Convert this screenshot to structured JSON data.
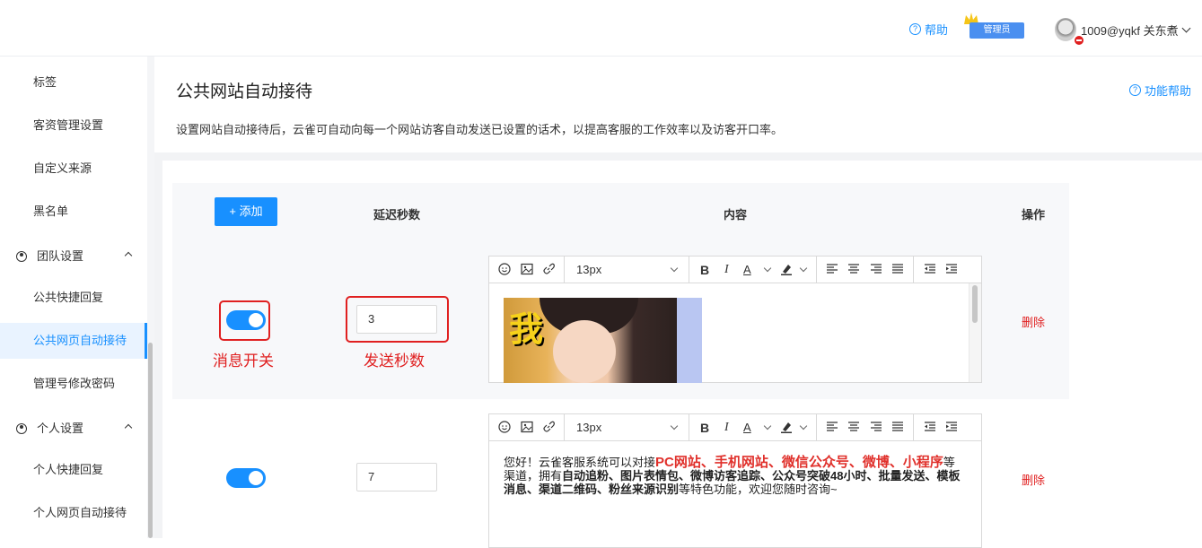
{
  "topbar": {
    "help_label": "帮助",
    "admin_badge": "管理员",
    "user_label": "1009@yqkf 关东煮"
  },
  "sidebar": {
    "items": [
      {
        "label": "标签"
      },
      {
        "label": "客资管理设置"
      },
      {
        "label": "自定义来源"
      },
      {
        "label": "黑名单"
      }
    ],
    "group_team": {
      "label": "团队设置",
      "items": [
        {
          "label": "公共快捷回复"
        },
        {
          "label": "公共网页自动接待"
        },
        {
          "label": "管理号修改密码"
        }
      ]
    },
    "group_personal": {
      "label": "个人设置",
      "items": [
        {
          "label": "个人快捷回复"
        },
        {
          "label": "个人网页自动接待"
        }
      ]
    }
  },
  "page": {
    "title": "公共网站自动接待",
    "func_help": "功能帮助",
    "description": "设置网站自动接待后，云雀可自动向每一个网站访客自动发送已设置的话术，以提高客服的工作效率以及访客开口率。"
  },
  "table": {
    "add_button": "+ 添加",
    "col_delay": "延迟秒数",
    "col_content": "内容",
    "col_action": "操作",
    "rows": [
      {
        "enabled": true,
        "delay": "3",
        "delete_label": "删除",
        "image_char": "我"
      },
      {
        "enabled": true,
        "delay": "7",
        "delete_label": "删除",
        "text_1": "您好！云雀客服系统可以对接",
        "text_red": "PC网站、手机网站、微信公众号、微博、小程序",
        "text_2": "等渠道，拥有",
        "text_bold": "自动追粉、图片表情包、微博访客追踪、公众号突破48小时、批量发送、模板消息、渠道二维码、粉丝来源识别",
        "text_3": "等特色功能，欢迎您随时咨询~"
      }
    ]
  },
  "editor": {
    "font_size": "13px"
  },
  "annotations": {
    "switch": "消息开关",
    "seconds": "发送秒数"
  },
  "colors": {
    "accent": "#1890ff",
    "annotation_red": "#e02020"
  }
}
